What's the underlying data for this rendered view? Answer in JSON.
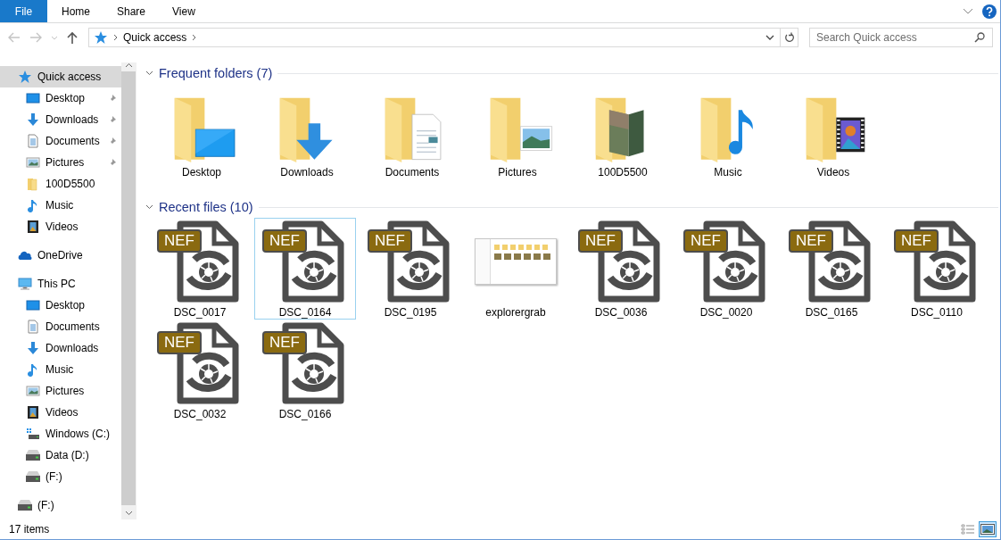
{
  "ribbon": {
    "tabs": [
      {
        "label": "File",
        "kind": "file"
      },
      {
        "label": "Home",
        "kind": "tab"
      },
      {
        "label": "Share",
        "kind": "tab"
      },
      {
        "label": "View",
        "kind": "tab"
      }
    ]
  },
  "address": {
    "path": [
      "Quick access"
    ]
  },
  "search": {
    "placeholder": "Search Quick access"
  },
  "sidebar": {
    "items": [
      {
        "label": "Quick access",
        "kind": "star",
        "selected": true,
        "children": [
          {
            "label": "Desktop",
            "kind": "desktop",
            "pinned": true,
            "selected": false
          },
          {
            "label": "Downloads",
            "kind": "downloads",
            "pinned": true,
            "selected": false
          },
          {
            "label": "Documents",
            "kind": "documents",
            "pinned": true,
            "selected": false
          },
          {
            "label": "Pictures",
            "kind": "pictures",
            "pinned": true,
            "selected": false
          },
          {
            "label": "100D5500",
            "kind": "folder",
            "pinned": false,
            "selected": false
          },
          {
            "label": "Music",
            "kind": "music",
            "pinned": false,
            "selected": false
          },
          {
            "label": "Videos",
            "kind": "videos",
            "pinned": false,
            "selected": false
          }
        ]
      },
      {
        "label": "OneDrive",
        "kind": "cloud",
        "selected": false
      },
      {
        "label": "This PC",
        "kind": "pc",
        "selected": false,
        "children": [
          {
            "label": "Desktop",
            "kind": "desktop",
            "pinned": false,
            "selected": false
          },
          {
            "label": "Documents",
            "kind": "documents",
            "pinned": false,
            "selected": false
          },
          {
            "label": "Downloads",
            "kind": "downloads",
            "pinned": false,
            "selected": false
          },
          {
            "label": "Music",
            "kind": "music",
            "pinned": false,
            "selected": false
          },
          {
            "label": "Pictures",
            "kind": "pictures",
            "pinned": false,
            "selected": false
          },
          {
            "label": "Videos",
            "kind": "videos",
            "pinned": false,
            "selected": false
          },
          {
            "label": "Windows (C:)",
            "kind": "system-drive",
            "pinned": false,
            "selected": false
          },
          {
            "label": "Data (D:)",
            "kind": "drive",
            "pinned": false,
            "selected": false
          },
          {
            "label": "(F:)",
            "kind": "drive",
            "pinned": false,
            "selected": false
          }
        ]
      },
      {
        "label": "(F:)",
        "kind": "drive",
        "selected": false
      }
    ]
  },
  "frequent_folders": {
    "title": "Frequent folders (7)",
    "items": [
      {
        "label": "Desktop",
        "kind": "desktop"
      },
      {
        "label": "Downloads",
        "kind": "downloads"
      },
      {
        "label": "Documents",
        "kind": "documents"
      },
      {
        "label": "Pictures",
        "kind": "pictures"
      },
      {
        "label": "100D5500",
        "kind": "photos"
      },
      {
        "label": "Music",
        "kind": "music"
      },
      {
        "label": "Videos",
        "kind": "videos"
      }
    ]
  },
  "recent_files": {
    "title": "Recent files (10)",
    "items": [
      {
        "name": "DSC_0017",
        "kind": "raw",
        "badge": "NEF",
        "selected": false
      },
      {
        "name": "DSC_0164",
        "kind": "raw",
        "badge": "NEF",
        "selected": true
      },
      {
        "name": "DSC_0195",
        "kind": "raw",
        "badge": "NEF",
        "selected": false
      },
      {
        "name": "explorergrab",
        "kind": "image",
        "selected": false
      },
      {
        "name": "DSC_0036",
        "kind": "raw",
        "badge": "NEF",
        "selected": false
      },
      {
        "name": "DSC_0020",
        "kind": "raw",
        "badge": "NEF",
        "selected": false
      },
      {
        "name": "DSC_0165",
        "kind": "raw",
        "badge": "NEF",
        "selected": false
      },
      {
        "name": "DSC_0110",
        "kind": "raw",
        "badge": "NEF",
        "selected": false
      },
      {
        "name": "DSC_0032",
        "kind": "raw",
        "badge": "NEF",
        "selected": false
      },
      {
        "name": "DSC_0166",
        "kind": "raw",
        "badge": "NEF",
        "selected": false
      }
    ]
  },
  "status_bar": {
    "count": "17 items",
    "views": [
      {
        "kind": "details",
        "selected": false
      },
      {
        "kind": "large-icons",
        "selected": true
      }
    ]
  }
}
